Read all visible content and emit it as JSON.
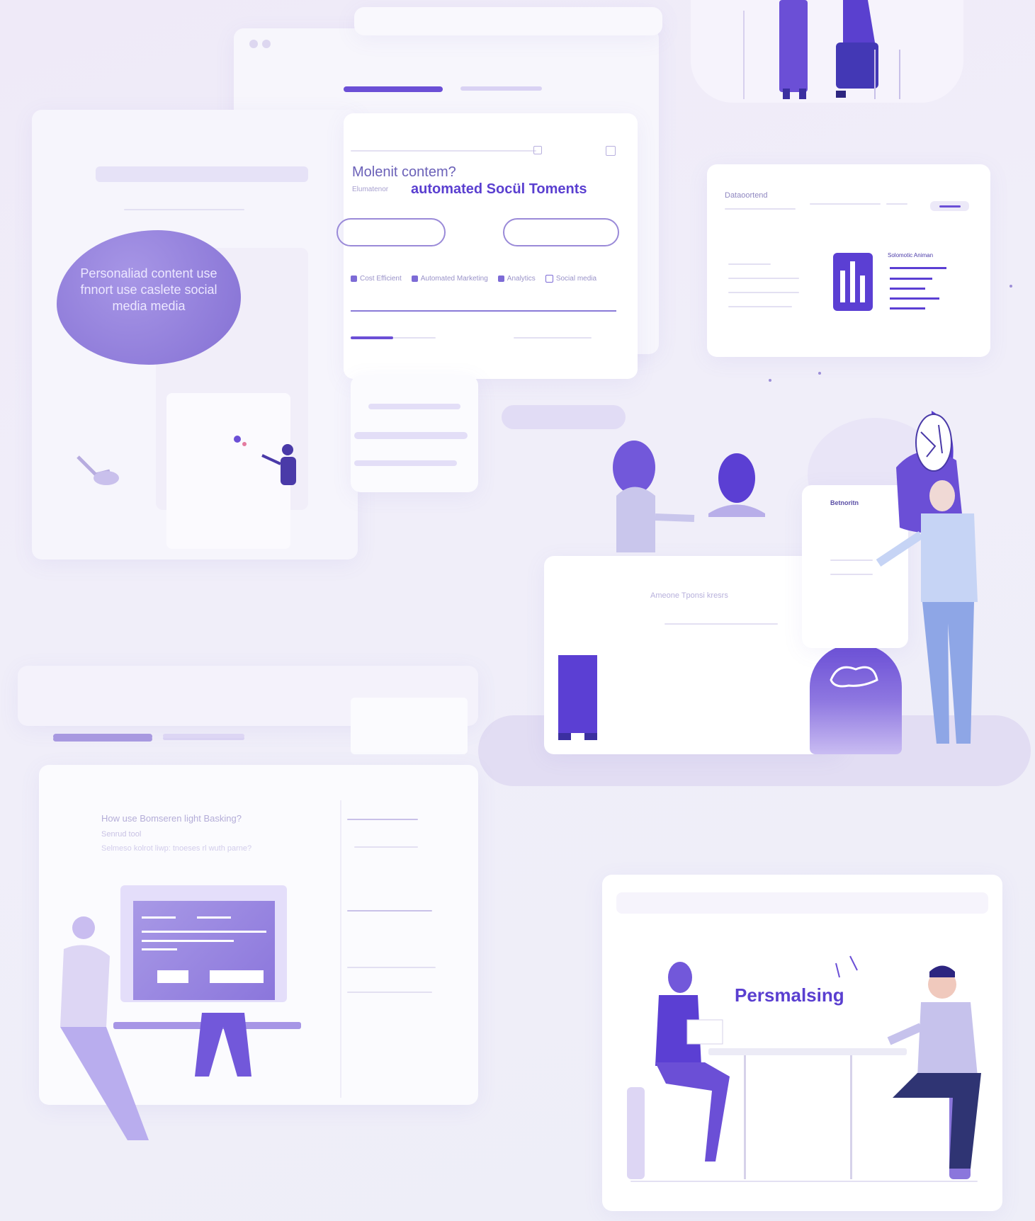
{
  "colors": {
    "accent": "#6b4fd6",
    "accent_light": "#a796e6",
    "background": "#efedf8",
    "card": "#fbfbfe",
    "text_dark": "#3b2fa0"
  },
  "hero_panel": {
    "question": "Molenit contem?",
    "subtitle_prefix": "Elumatenor",
    "subtitle_highlight": "automated Socül Toments",
    "options": [
      "Cost Efficient",
      "Automated Marketing",
      "Analytics",
      "Social media"
    ]
  },
  "bubble": {
    "text": "Personaliad content use fnnort use caslete social media media"
  },
  "dashboard_card": {
    "title": "Dataoortend",
    "chart_label": "Solomotic Animan"
  },
  "meeting_card": {
    "badge": "Betnoritn",
    "center_text": "Ameone Tponsi kresrs"
  },
  "bottom_left_panel": {
    "question": "How use Bomseren light Basking?",
    "sub1": "Senrud tool",
    "sub2": "Selmeso kolrot liwp: tnoeses rl wuth parne?"
  },
  "bottom_right_card": {
    "label": "Persmalsing"
  }
}
